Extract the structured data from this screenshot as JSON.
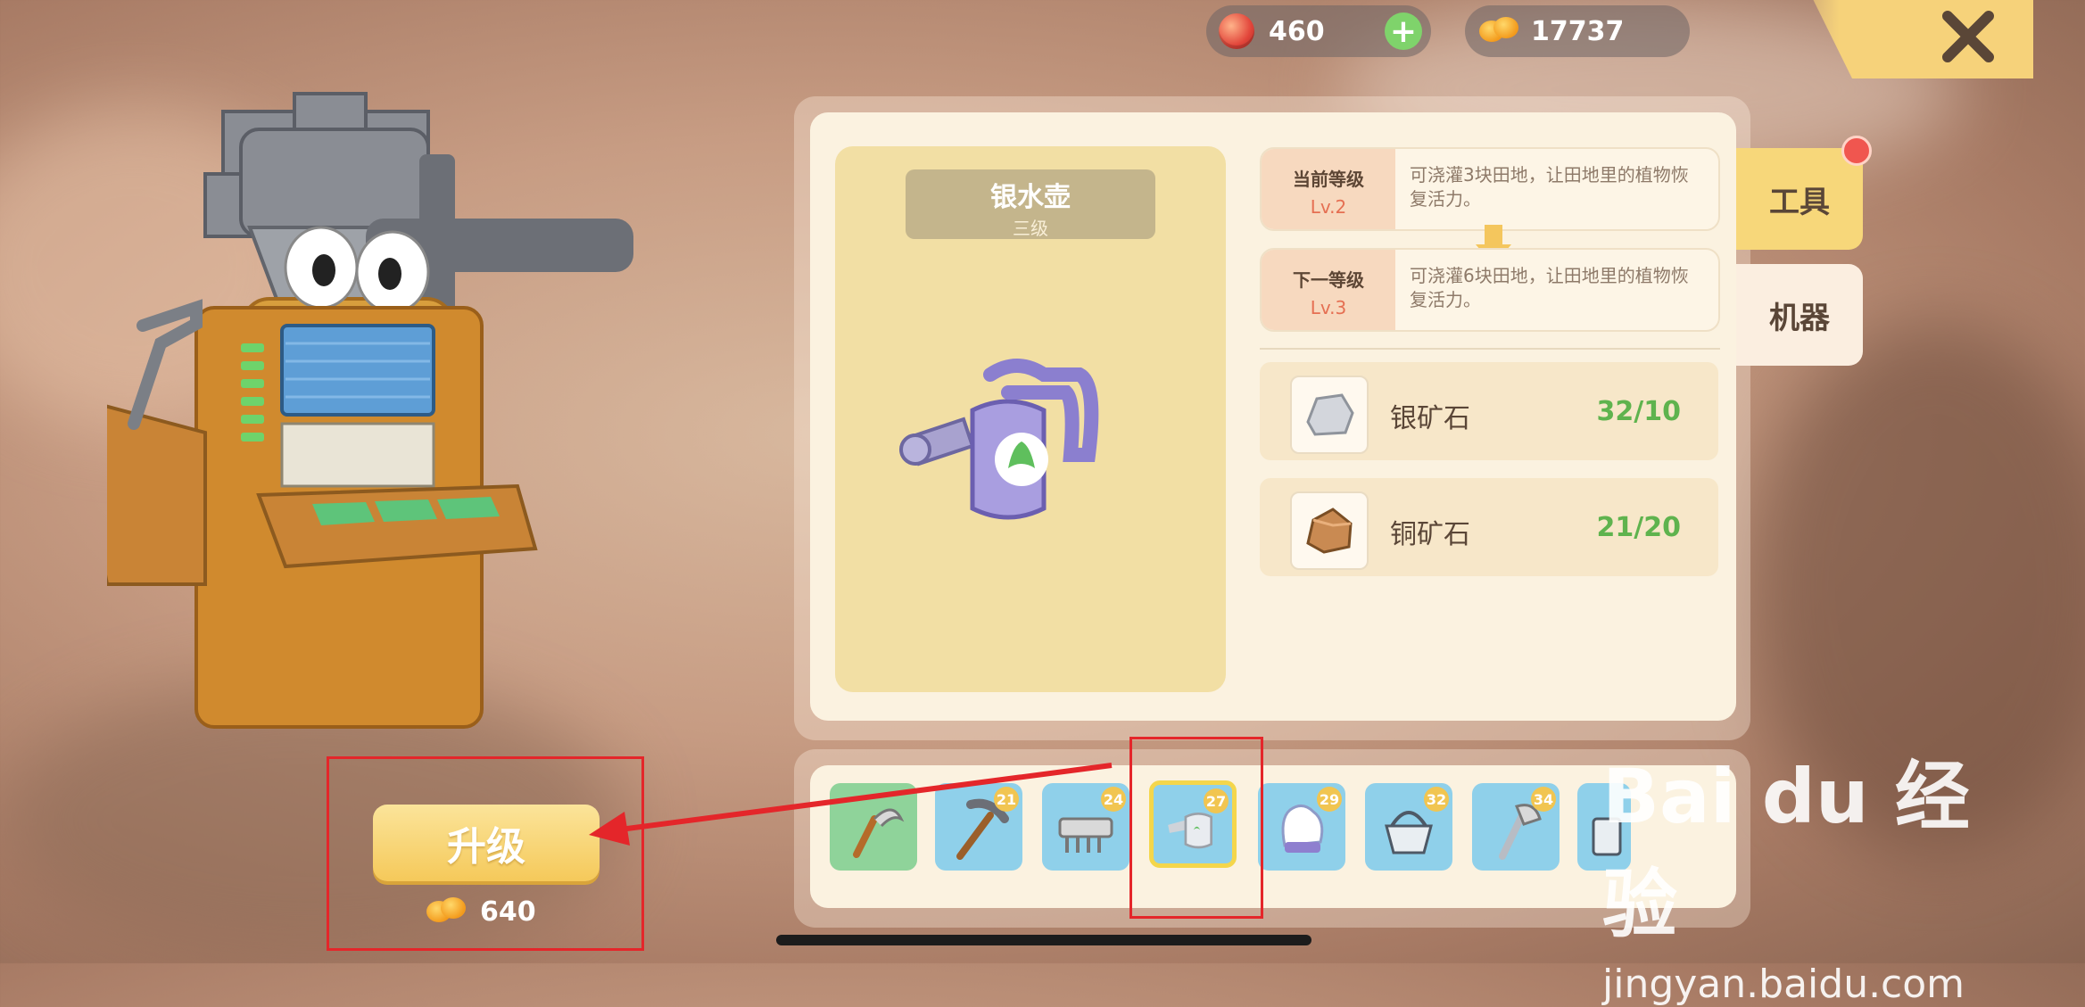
{
  "currencies": {
    "gems": "460",
    "beans": "17737"
  },
  "item": {
    "name": "银水壶",
    "tier": "三级"
  },
  "levels": {
    "current": {
      "label": "当前等级",
      "value": "Lv.2",
      "desc": "可浇灌3块田地，让田地里的植物恢复活力。"
    },
    "next": {
      "label": "下一等级",
      "value": "Lv.3",
      "desc": "可浇灌6块田地，让田地里的植物恢复活力。"
    }
  },
  "materials": [
    {
      "name": "银矿石",
      "count": "32/10"
    },
    {
      "name": "铜矿石",
      "count": "21/20"
    }
  ],
  "tabs": {
    "tools": "工具",
    "machines": "机器"
  },
  "tools": [
    {
      "icon": "sickle-icon",
      "level": ""
    },
    {
      "icon": "pickaxe-icon",
      "level": "21"
    },
    {
      "icon": "rake-icon",
      "level": "24"
    },
    {
      "icon": "watering-can-icon",
      "level": "27"
    },
    {
      "icon": "glove-icon",
      "level": "29"
    },
    {
      "icon": "basket-icon",
      "level": "32"
    },
    {
      "icon": "axe-icon",
      "level": "34"
    },
    {
      "icon": "tool-icon",
      "level": ""
    }
  ],
  "upgrade": {
    "label": "升级",
    "cost": "640"
  },
  "watermark": {
    "brand": "Bai du 经验",
    "url": "jingyan.baidu.com"
  },
  "colors": {
    "accent": "#f7d77a",
    "count_ok": "#5fb34e",
    "highlight_red": "#e4262a"
  }
}
